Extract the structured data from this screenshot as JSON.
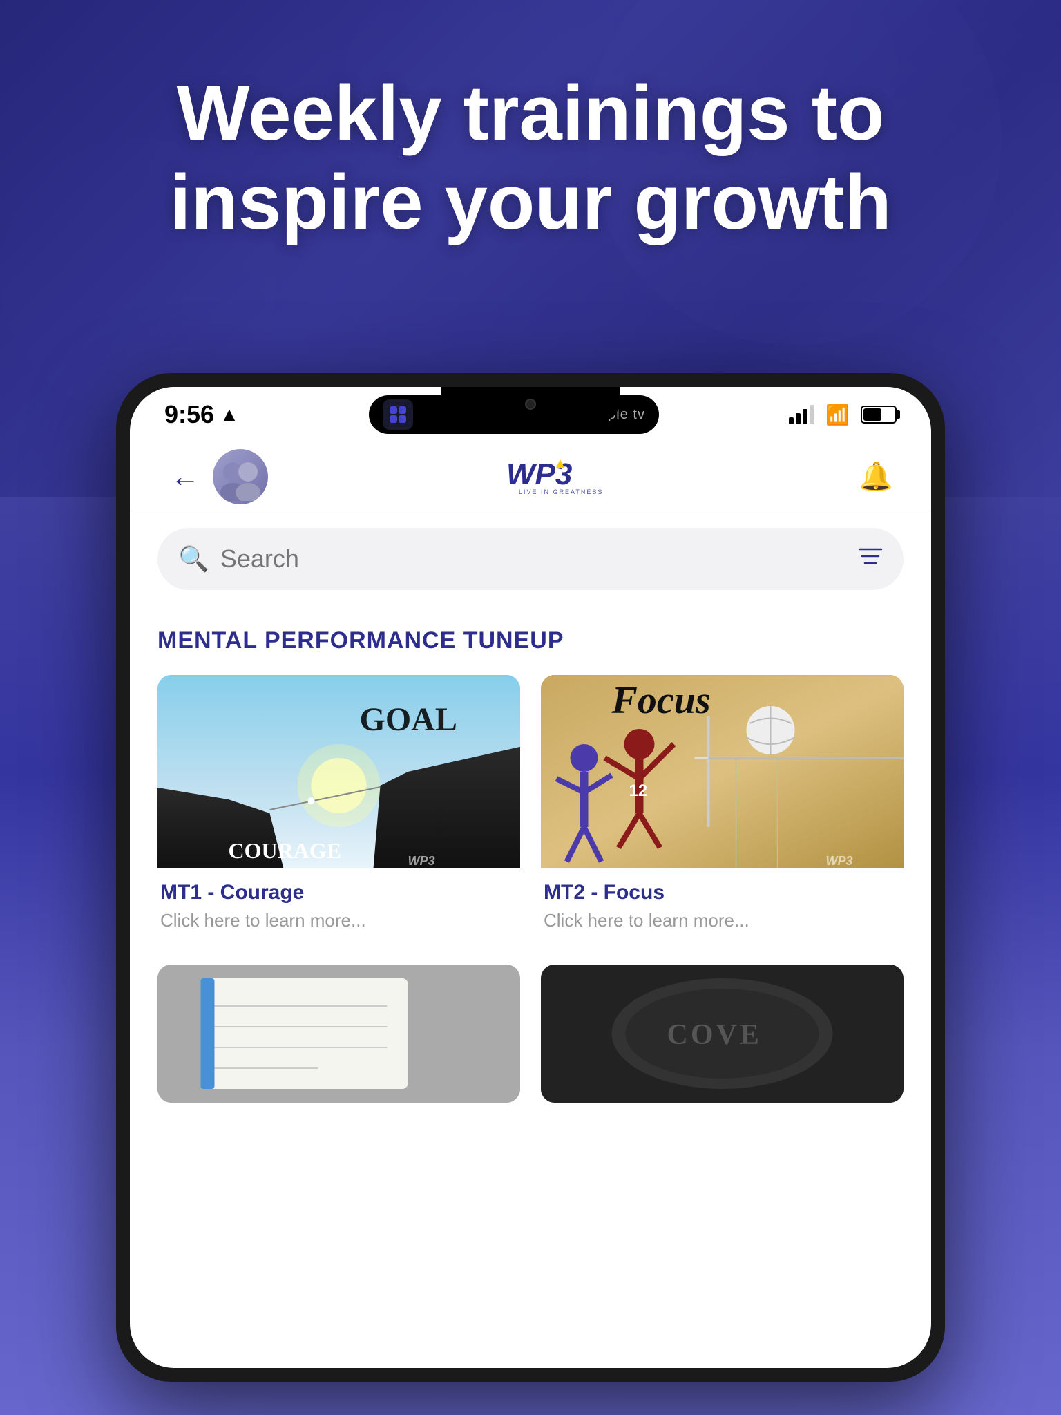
{
  "hero": {
    "title_line1": "Weekly trainings to",
    "title_line2": "inspire your growth"
  },
  "status_bar": {
    "time": "9:56",
    "location_arrow": "▶",
    "app_label": "apple tv"
  },
  "header": {
    "back_label": "←",
    "logo_main": "WP3",
    "logo_sub": "LIVE IN GREATNESS",
    "bell_label": "🔔"
  },
  "search": {
    "placeholder": "Search",
    "filter_icon": "⊿"
  },
  "section": {
    "title": "MENTAL PERFORMANCE TUNEUP"
  },
  "cards": [
    {
      "id": "mt1",
      "label": "MT1 - Courage",
      "subtitle": "Click here to learn more...",
      "image_top_text": "GOAL",
      "image_bottom_text": "COURAGE",
      "watermark": "WP3"
    },
    {
      "id": "mt2",
      "label": "MT2 - Focus",
      "subtitle": "Click here to learn more...",
      "image_text": "Focus",
      "watermark": "WP3"
    },
    {
      "id": "mt3",
      "label": "",
      "subtitle": "",
      "image_text": ""
    },
    {
      "id": "mt4",
      "label": "",
      "subtitle": "",
      "image_text": ""
    }
  ]
}
